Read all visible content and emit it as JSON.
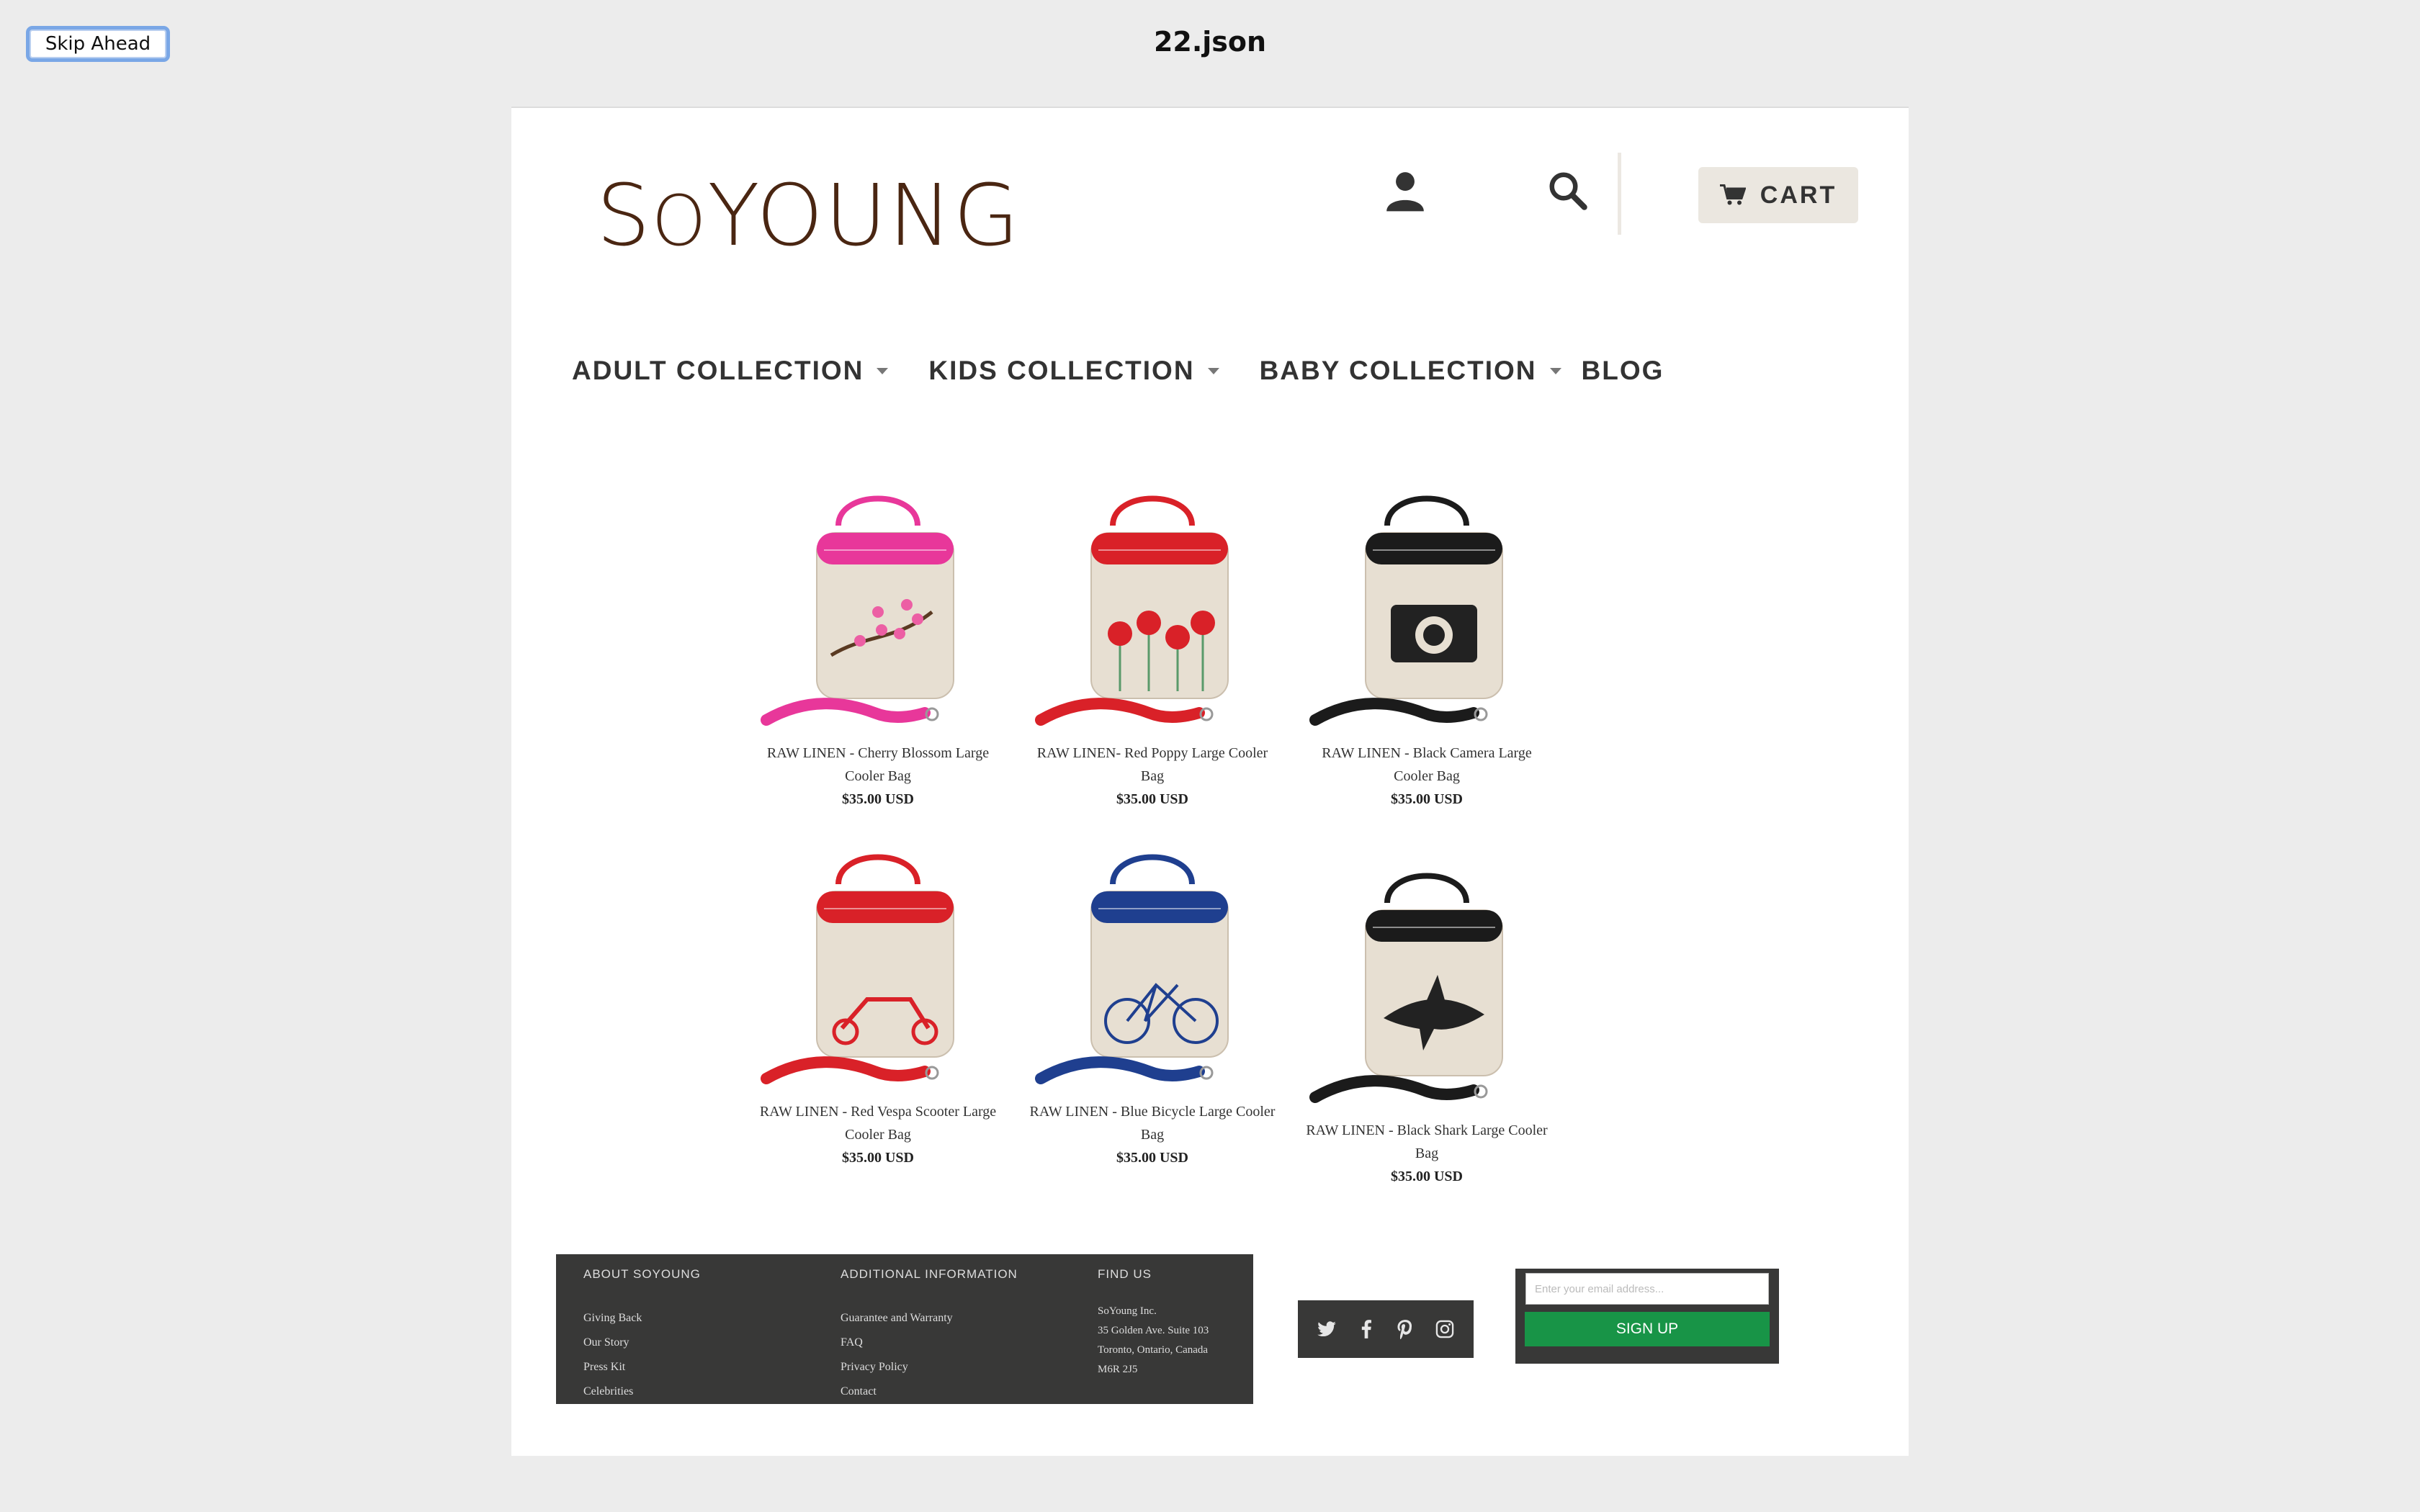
{
  "frame": {
    "skip_label": "Skip Ahead",
    "title": "22.json"
  },
  "header": {
    "logo": "SoYoung",
    "cart_label": "CART"
  },
  "nav": {
    "items": [
      {
        "label": "ADULT COLLECTION",
        "has_dropdown": true
      },
      {
        "label": "KIDS COLLECTION",
        "has_dropdown": true
      },
      {
        "label": "BABY COLLECTION",
        "has_dropdown": true
      },
      {
        "label": "BLOG",
        "has_dropdown": false
      }
    ]
  },
  "products": [
    {
      "name": "RAW LINEN - Cherry Blossom Large Cooler Bag",
      "price": "$35.00 USD",
      "accent": "#e8379a",
      "motif": "cherry-blossom"
    },
    {
      "name": "RAW LINEN- Red Poppy Large Cooler Bag",
      "price": "$35.00 USD",
      "accent": "#d92128",
      "motif": "poppy"
    },
    {
      "name": "RAW LINEN - Black Camera Large Cooler Bag",
      "price": "$35.00 USD",
      "accent": "#1b1b1b",
      "motif": "camera"
    },
    {
      "name": "RAW LINEN - Red Vespa Scooter Large Cooler Bag",
      "price": "$35.00 USD",
      "accent": "#d92128",
      "motif": "scooter"
    },
    {
      "name": "RAW LINEN - Blue Bicycle Large Cooler Bag",
      "price": "$35.00 USD",
      "accent": "#1f3f8f",
      "motif": "bicycle"
    },
    {
      "name": "RAW LINEN - Black Shark Large Cooler Bag",
      "price": "$35.00 USD",
      "accent": "#1b1b1b",
      "motif": "shark"
    }
  ],
  "footer": {
    "about": {
      "heading": "ABOUT SOYOUNG",
      "links": [
        "Giving Back",
        "Our Story",
        "Press Kit",
        "Celebrities"
      ]
    },
    "additional": {
      "heading": "ADDITIONAL INFORMATION",
      "links": [
        "Guarantee and Warranty",
        "FAQ",
        "Privacy Policy",
        "Contact"
      ]
    },
    "find_us": {
      "heading": "FIND US",
      "lines": [
        "SoYoung Inc.",
        "35 Golden Ave. Suite 103",
        "Toronto, Ontario, Canada",
        "M6R 2J5"
      ]
    },
    "social": [
      "twitter-icon",
      "facebook-icon",
      "pinterest-icon",
      "instagram-icon"
    ],
    "newsletter": {
      "placeholder": "Enter your email address...",
      "button_label": "SIGN UP"
    }
  },
  "colors": {
    "logo": "#4a2612",
    "footer_bg": "#383837",
    "signup_green": "#189447",
    "cart_bg": "#ebe7e0"
  }
}
